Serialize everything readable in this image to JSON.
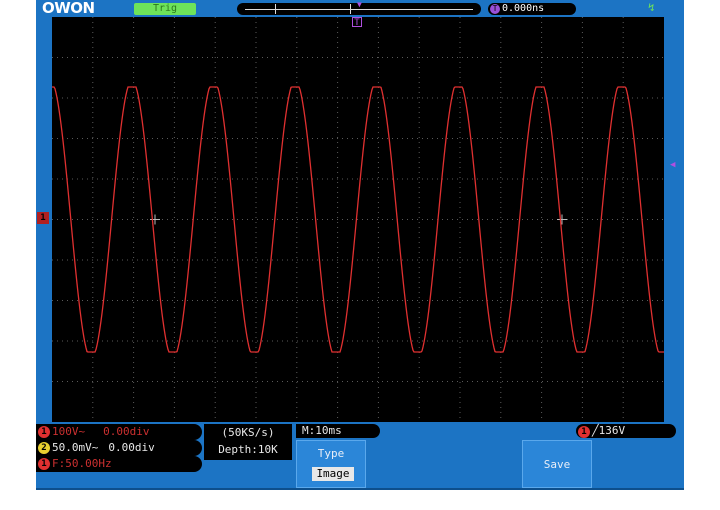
{
  "brand": {
    "logo": "OWON"
  },
  "trigger_status": "Trig",
  "time_offset": {
    "badge": "T",
    "value": "0.000ns"
  },
  "trigger_position_marker": "T",
  "channel1_marker": "1",
  "channel1": {
    "badge": "1",
    "scale": "100V~",
    "position": "0.00div"
  },
  "channel2": {
    "badge": "2",
    "scale": "50.0mV~",
    "position": "0.00div"
  },
  "frequency": {
    "badge": "1",
    "value": "F:50.00Hz"
  },
  "acquisition": {
    "sample_rate": "(50KS/s)",
    "depth": "Depth:10K"
  },
  "timebase": "M:10ms",
  "trigger": {
    "badge": "1",
    "edge": "╱",
    "level": "136V"
  },
  "menu": {
    "type_label": "Type",
    "type_value": "Image",
    "save_label": "Save"
  },
  "colors": {
    "background": "#1c74c4",
    "screen": "#000000",
    "ch1": "#e03030",
    "ch2": "#e8d030",
    "trigger_marker": "#b050e0",
    "trig_status": "#6ee35a"
  },
  "waveform": {
    "channel": "CH1",
    "shape": "sine",
    "frequency_hz": 50,
    "cycles_visible": 7.5
  }
}
